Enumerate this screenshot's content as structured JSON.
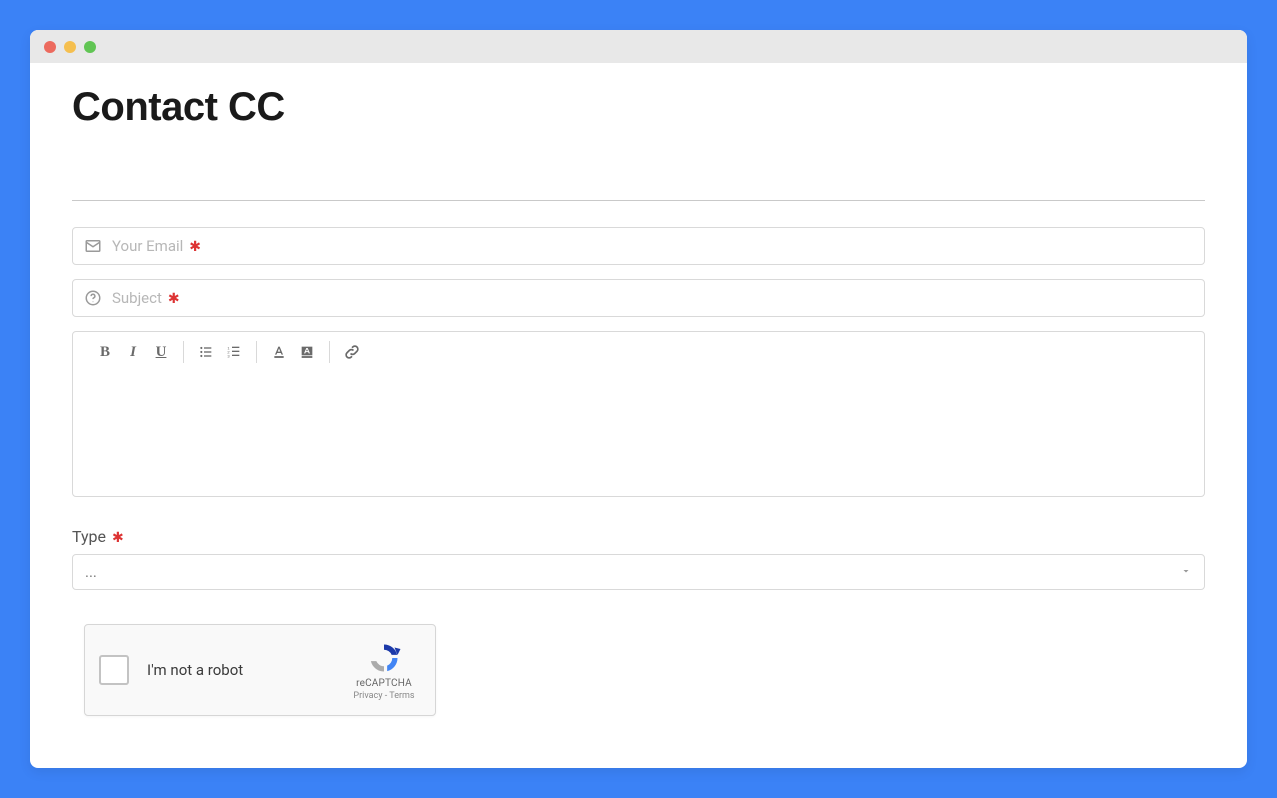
{
  "page": {
    "title": "Contact CC"
  },
  "form": {
    "email": {
      "placeholder": "Your Email",
      "value": "",
      "required": true
    },
    "subject": {
      "placeholder": "Subject",
      "value": "",
      "required": true
    },
    "message": {
      "value": ""
    },
    "type": {
      "label": "Type",
      "required": true,
      "selected": "..."
    }
  },
  "toolbar": {
    "bold": "B",
    "italic": "I",
    "underline": "U"
  },
  "captcha": {
    "label": "I'm not a robot",
    "brand": "reCAPTCHA",
    "privacy": "Privacy",
    "terms": "Terms",
    "separator": " - "
  },
  "glyphs": {
    "required": "✱"
  }
}
